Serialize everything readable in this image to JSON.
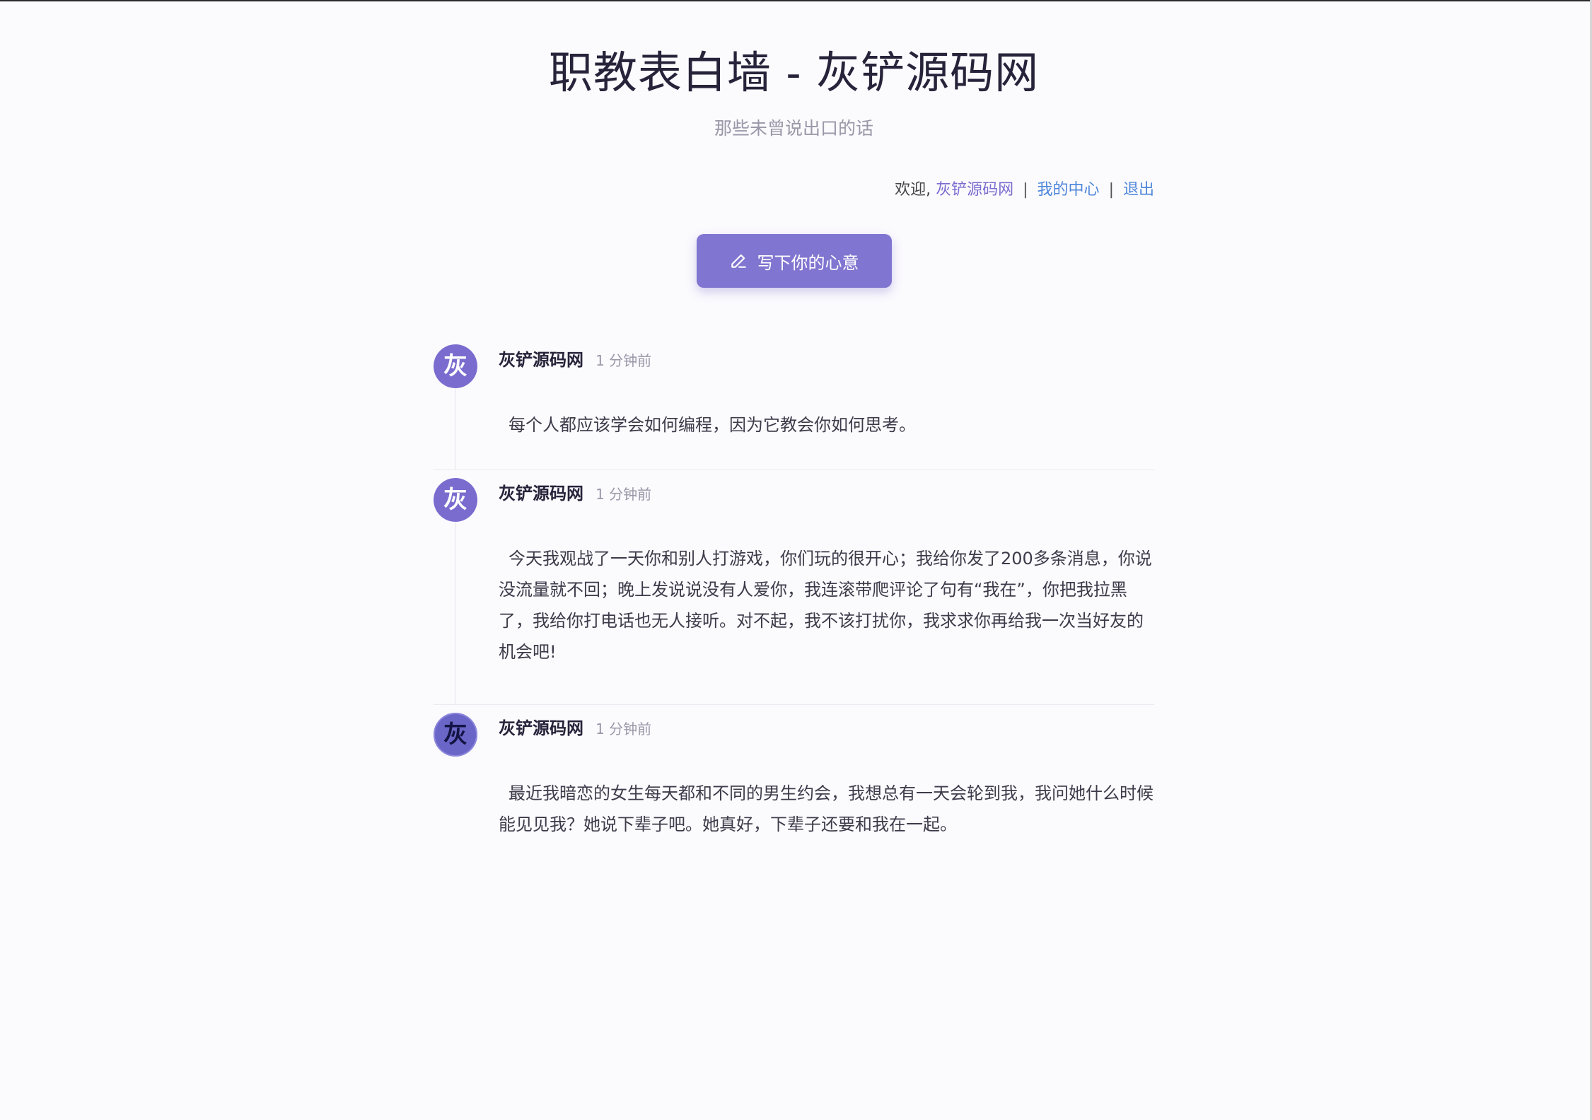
{
  "header": {
    "title": "职教表白墙 - 灰铲源码网",
    "subtitle": "那些未曾说出口的话"
  },
  "userbar": {
    "welcome": "欢迎,",
    "username": "灰铲源码网",
    "separator": "|",
    "center_link": "我的中心",
    "logout_link": "退出"
  },
  "write_button": {
    "label": "写下你的心意",
    "icon": "pencil-icon"
  },
  "colors": {
    "accent": "#8075d0",
    "link": "#4d86d9",
    "avatar": "#7a6ccf"
  },
  "posts": [
    {
      "avatar": "灰",
      "author": "灰铲源码网",
      "time": "1 分钟前",
      "content": "每个人都应该学会如何编程，因为它教会你如何思考。"
    },
    {
      "avatar": "灰",
      "author": "灰铲源码网",
      "time": "1 分钟前",
      "content": "今天我观战了一天你和别人打游戏，你们玩的很开心；我给你发了200多条消息，你说没流量就不回；晚上发说说没有人爱你，我连滚带爬评论了句有“我在”，你把我拉黑了，我给你打电话也无人接听。对不起，我不该打扰你，我求求你再给我一次当好友的机会吧!"
    },
    {
      "avatar": "灰",
      "author": "灰铲源码网",
      "time": "1 分钟前",
      "content": "最近我暗恋的女生每天都和不同的男生约会，我想总有一天会轮到我，我问她什么时候能见见我？她说下辈子吧。她真好，下辈子还要和我在一起。"
    }
  ]
}
